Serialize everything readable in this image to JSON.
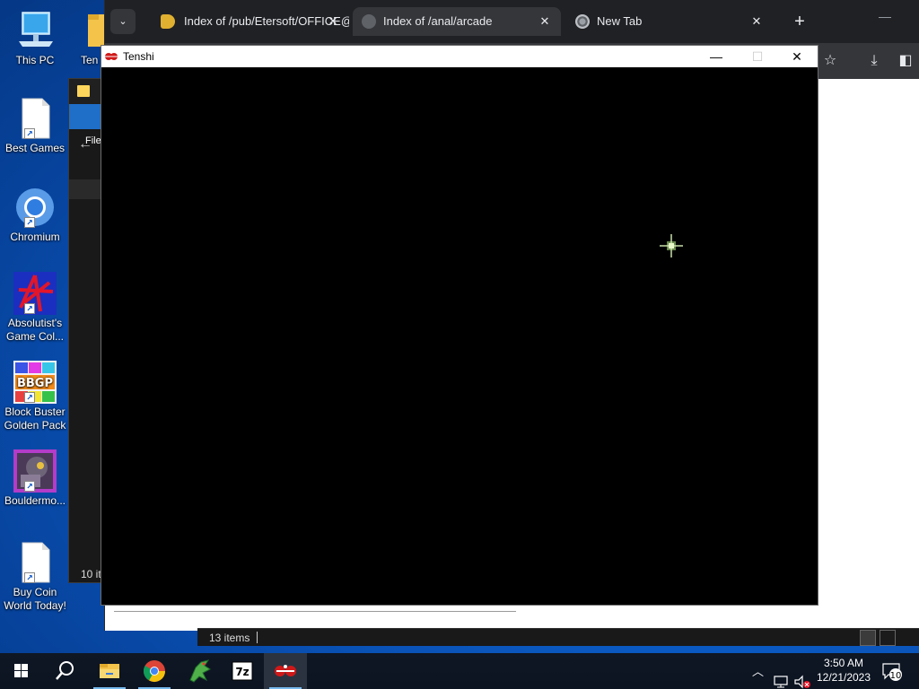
{
  "desktop": {
    "icons": [
      {
        "label": "This PC"
      },
      {
        "label": "Ten"
      },
      {
        "label": "Best Games"
      },
      {
        "label": "Chromium"
      },
      {
        "label": "Absolutist's Game Col..."
      },
      {
        "label": "Block Buster Golden Pack"
      },
      {
        "label": "Bouldermo..."
      },
      {
        "label": "Buy Coin World Today!"
      }
    ]
  },
  "browser": {
    "tabs": [
      {
        "title": "Index of /pub/Etersoft/OFFICE@",
        "close": "✕"
      },
      {
        "title": "Index of /anal/arcade",
        "close": "✕"
      },
      {
        "title": "New Tab",
        "close": "✕"
      }
    ],
    "new_tab": "+",
    "minimize": "—",
    "toolbar": {
      "star": "☆",
      "download": "⤓",
      "sidepanel": "◧"
    }
  },
  "explorer": {
    "file_tab": "File",
    "item_count_short": "10 it",
    "status_count": "13 items"
  },
  "tenshi": {
    "title": "Tenshi",
    "minimize": "—",
    "maximize": "☐",
    "close": "✕"
  },
  "taskbar": {
    "time": "3:50 AM",
    "date": "12/21/2023",
    "notification_count": "10",
    "tray_chevron": "︿",
    "apps": [
      "start-icon",
      "search-icon",
      "file-explorer-icon",
      "chrome-icon",
      "dragon-game-icon",
      "7zip-icon",
      "tenshi-icon"
    ],
    "seven_zip_label": "7z"
  },
  "colors": {
    "desktop_bg": "#0b5cc7",
    "browser_chrome": "#202124",
    "taskbar": "#0f1724",
    "explorer_accent": "#1f6ec8"
  }
}
